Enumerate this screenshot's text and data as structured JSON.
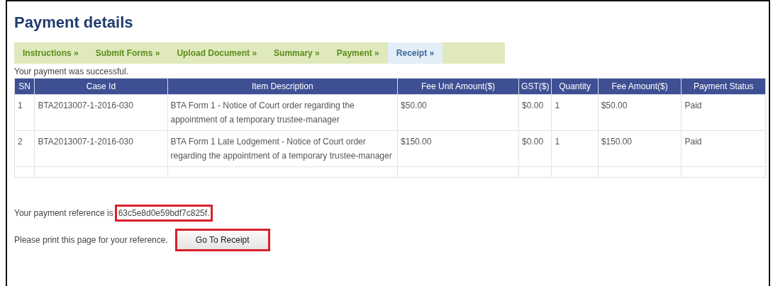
{
  "title": "Payment details",
  "tabs": [
    {
      "label": "Instructions »",
      "selected": false
    },
    {
      "label": "Submit Forms »",
      "selected": false
    },
    {
      "label": "Upload Document »",
      "selected": false
    },
    {
      "label": "Summary »",
      "selected": false
    },
    {
      "label": "Payment »",
      "selected": false
    },
    {
      "label": "Receipt »",
      "selected": true
    }
  ],
  "message": "Your payment was successful.",
  "table": {
    "columns": [
      "SN",
      "Case Id",
      "Item Description",
      "Fee Unit Amount($)",
      "GST($)",
      "Quantity",
      "Fee Amount($)",
      "Payment Status"
    ],
    "rows": [
      [
        "1",
        "BTA2013007-1-2016-030",
        "BTA Form 1 - Notice of Court order regarding the appointment of a temporary trustee-manager",
        "$50.00",
        "$0.00",
        "1",
        "$50.00",
        "Paid"
      ],
      [
        "2",
        "BTA2013007-1-2016-030",
        "BTA Form 1 Late Lodgement - Notice of Court order regarding the appointment of a temporary trustee-manager",
        "$150.00",
        "$0.00",
        "1",
        "$150.00",
        "Paid"
      ]
    ]
  },
  "reference_label": "Your payment reference is",
  "reference": "63c5e8d0e59bdf7c825f.",
  "print_note": "Please print this page for your reference.",
  "receipt_button": "Go To Receipt"
}
